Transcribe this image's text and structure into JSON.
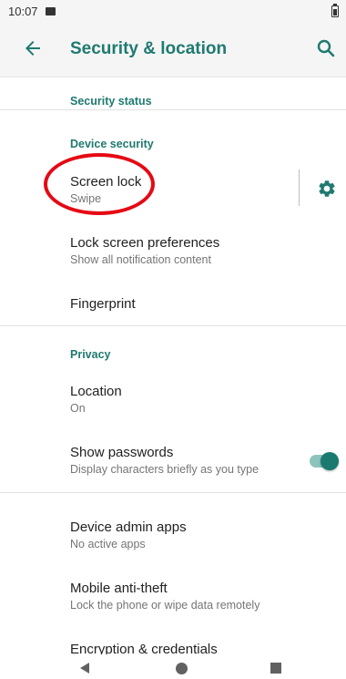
{
  "status_bar": {
    "time": "10:07"
  },
  "app_bar": {
    "title": "Security & location"
  },
  "sections": {
    "security_status": "Security status",
    "device_security": "Device security",
    "privacy": "Privacy"
  },
  "items": {
    "screen_lock": {
      "title": "Screen lock",
      "subtitle": "Swipe"
    },
    "lock_screen_prefs": {
      "title": "Lock screen preferences",
      "subtitle": "Show all notification content"
    },
    "fingerprint": {
      "title": "Fingerprint"
    },
    "location": {
      "title": "Location",
      "subtitle": "On"
    },
    "show_passwords": {
      "title": "Show passwords",
      "subtitle": "Display characters briefly as you type",
      "enabled": true
    },
    "device_admin": {
      "title": "Device admin apps",
      "subtitle": "No active apps"
    },
    "anti_theft": {
      "title": "Mobile anti-theft",
      "subtitle": "Lock the phone or wipe data remotely"
    },
    "encryption": {
      "title": "Encryption & credentials"
    }
  },
  "colors": {
    "accent": "#1f7a70",
    "highlight_ring": "#e50914",
    "toggle_track": "#8cc4bd"
  },
  "icons": [
    "back-arrow-icon",
    "search-icon",
    "gear-icon",
    "nav-back-icon",
    "nav-home-icon",
    "nav-recents-icon"
  ]
}
